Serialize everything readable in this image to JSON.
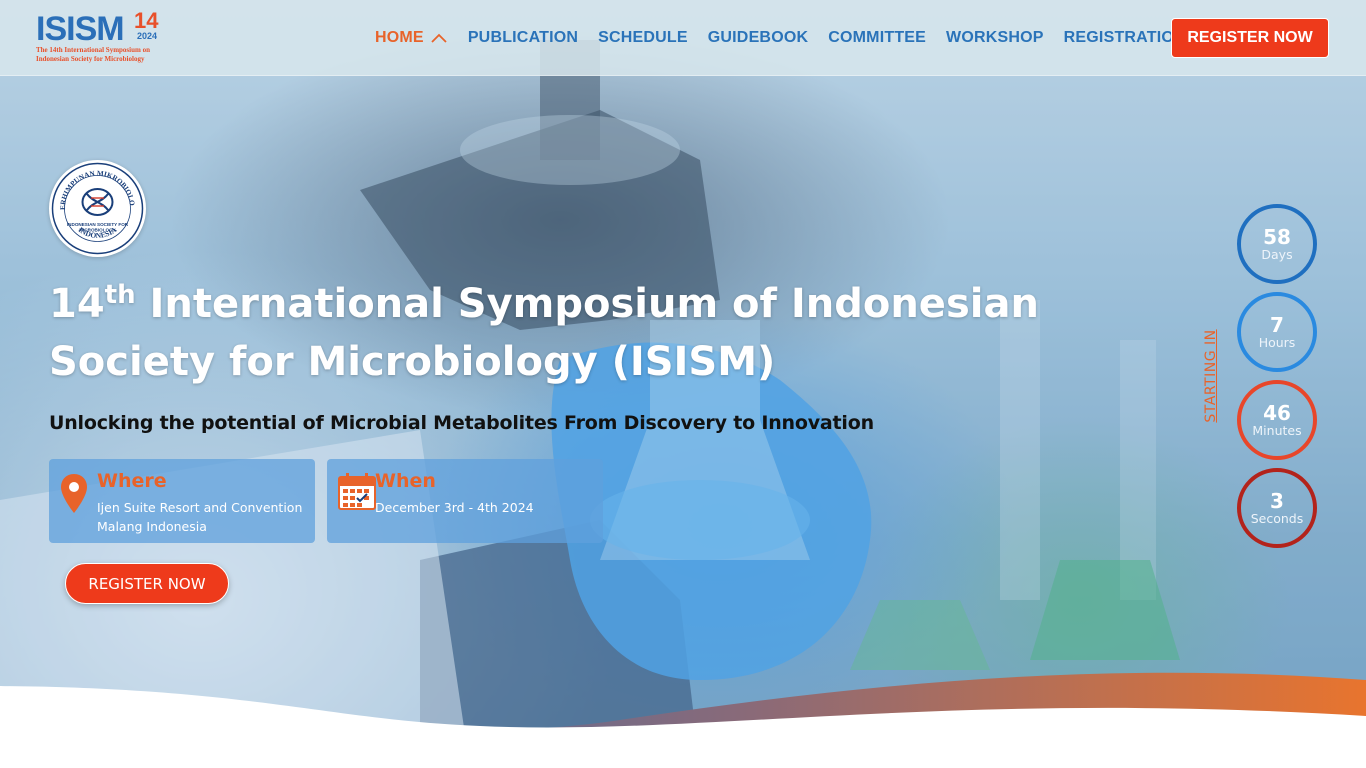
{
  "colors": {
    "accent": "#ee3a1b",
    "nav_blue": "#2a73b9",
    "nav_active": "#e8632a",
    "days_ring": "#1f6fc0",
    "hours_ring": "#2a8ae0",
    "minutes_ring": "#e8462a",
    "seconds_ring": "#b3231b"
  },
  "logo": {
    "main": "ISISM",
    "num": "14",
    "year": "2024",
    "sub_line1": "The 14th International Symposium on",
    "sub_line2": "Indonesian Society for Microbiology"
  },
  "nav": {
    "items": [
      "HOME",
      "PUBLICATION",
      "SCHEDULE",
      "GUIDEBOOK",
      "COMMITTEE",
      "WORKSHOP",
      "REGISTRATION"
    ],
    "active": "HOME",
    "register_label": "REGISTER NOW"
  },
  "society_logo": {
    "ring_top": "PERHIMPUNAN MIKROBIOLOGI",
    "ring_bottom": "INDONESIA",
    "center_line1": "INDONESIAN SOCIETY FOR",
    "center_line2": "MICROBIOLOGY"
  },
  "hero": {
    "title_num": "14",
    "title_sup": "th",
    "title_rest": " International Symposium of Indonesian Society for Microbiology (ISISM)",
    "subtitle": "Unlocking the potential of Microbial Metabolites From Discovery to Innovation",
    "where_title": "Where",
    "where_line1": "Ijen Suite Resort and Convention",
    "where_line2": "Malang Indonesia",
    "when_title": "When",
    "when_text": "December 3rd - 4th 2024",
    "register_label": "REGISTER NOW"
  },
  "countdown": {
    "starting_label": "STARTING IN",
    "days": "58",
    "days_label": "Days",
    "hours": "7",
    "hours_label": "Hours",
    "minutes": "46",
    "minutes_label": "Minutes",
    "seconds": "3",
    "seconds_label": "Seconds"
  }
}
